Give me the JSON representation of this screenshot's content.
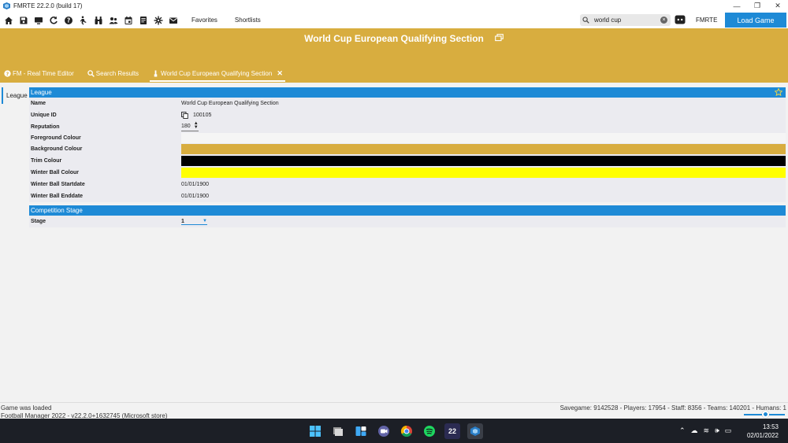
{
  "window": {
    "title": "FMRTE 22.2.0 (build 17)",
    "controls": {
      "minimize": "—",
      "maximize": "❐",
      "close": "✕"
    }
  },
  "toolbar": {
    "icons": [
      "home-icon",
      "save-icon",
      "monitor-icon",
      "refresh-icon",
      "help-icon",
      "walker-icon",
      "binoculars-icon",
      "people-icon",
      "calendar-icon",
      "notes-icon",
      "gear-icon",
      "mail-icon"
    ],
    "favorites_label": "Favorites",
    "shortlists_label": "Shortlists",
    "search_value": "world cup",
    "search_clear": "×",
    "fmrte_label": "FMRTE",
    "load_game_label": "Load Game"
  },
  "header": {
    "title": "World Cup European Qualifying Section",
    "background_color": "#d8ad3f",
    "tabs": [
      {
        "label": "FM - Real Time Editor",
        "icon": "help-circle-icon"
      },
      {
        "label": "Search Results",
        "icon": "search-icon"
      },
      {
        "label": "World Cup European Qualifying Section",
        "icon": "trophy-icon",
        "close": "✕"
      }
    ]
  },
  "sidebar": {
    "tab_label": "League"
  },
  "league": {
    "header": "League",
    "rows": {
      "name_label": "Name",
      "name_value": "World Cup European Qualifying Section",
      "uid_label": "Unique ID",
      "uid_value": "100105",
      "reputation_label": "Reputation",
      "reputation_value": "180",
      "foreground_label": "Foreground Colour",
      "foreground_color": "#f5f5f5",
      "background_label": "Background Colour",
      "background_color": "#d8ad3f",
      "trim_label": "Trim Colour",
      "trim_color": "#000000",
      "winter_ball_label": "Winter Ball Colour",
      "winter_ball_color": "#ffff00",
      "startdate_label": "Winter Ball Startdate",
      "startdate_value": "01/01/1900",
      "enddate_label": "Winter Ball Enddate",
      "enddate_value": "01/01/1900"
    }
  },
  "competition": {
    "header": "Competition Stage",
    "stage_label": "Stage",
    "stage_value": "1"
  },
  "status": {
    "line1": "Game was loaded",
    "line2": "Football Manager 2022 - v22.2.0+1632745 (Microsoft store)",
    "stats": "Savegame: 9142528 - Players: 17954 - Staff: 8356 - Teams: 140201 - Humans: 1"
  },
  "taskbar": {
    "icons": [
      "windows-start-icon",
      "file-explorer-icon",
      "widgets-icon",
      "teams-chat-icon",
      "chrome-icon",
      "spotify-icon",
      "fm22-icon",
      "fmrte-icon"
    ],
    "fm_label": "22",
    "time": "13:53",
    "date": "02/01/2022"
  },
  "colors": {
    "accent": "#1e8ad6",
    "gold": "#d8ad3f"
  }
}
